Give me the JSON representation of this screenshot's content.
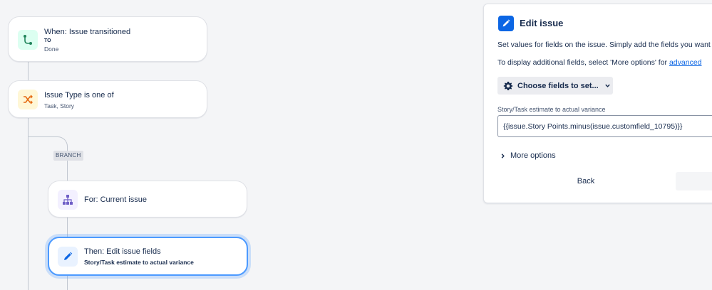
{
  "flow": {
    "trigger": {
      "title": "When: Issue transitioned",
      "meta_label": "TO",
      "meta_value": "Done"
    },
    "condition": {
      "title": "Issue Type is one of",
      "value": "Task, Story"
    },
    "branch": {
      "tag": "BRANCH"
    },
    "for_each": {
      "title": "For: Current issue"
    },
    "action": {
      "title": "Then: Edit issue fields",
      "value": "Story/Task estimate to actual variance"
    }
  },
  "panel": {
    "title": "Edit issue",
    "description": "Set values for fields on the issue. Simply add the fields you want",
    "hint_prefix": "To display additional fields, select 'More options' for ",
    "hint_link": "advanced",
    "choose_button": "Choose fields to set...",
    "field_label": "Story/Task estimate to actual variance",
    "field_value": "{{issue.Story Points.minus(issue.customfield_10795)}}",
    "more_options": "More options",
    "back_button": "Back"
  },
  "icons": {
    "trigger": "transition-icon",
    "condition": "shuffle-icon",
    "for_each": "hierarchy-icon",
    "action": "pencil-icon",
    "panel": "pencil-icon",
    "choose": "gear-icon"
  },
  "colors": {
    "trigger_bg": "#dcfff1",
    "trigger_fg": "#1f845a",
    "condition_bg": "#fff7d6",
    "condition_fg": "#e56910",
    "branch_bg": "#f3f0ff",
    "branch_fg": "#6e5dc6",
    "action_bg": "#e9f2ff",
    "action_fg": "#0c66e4",
    "selected_border": "#4c9aff"
  }
}
